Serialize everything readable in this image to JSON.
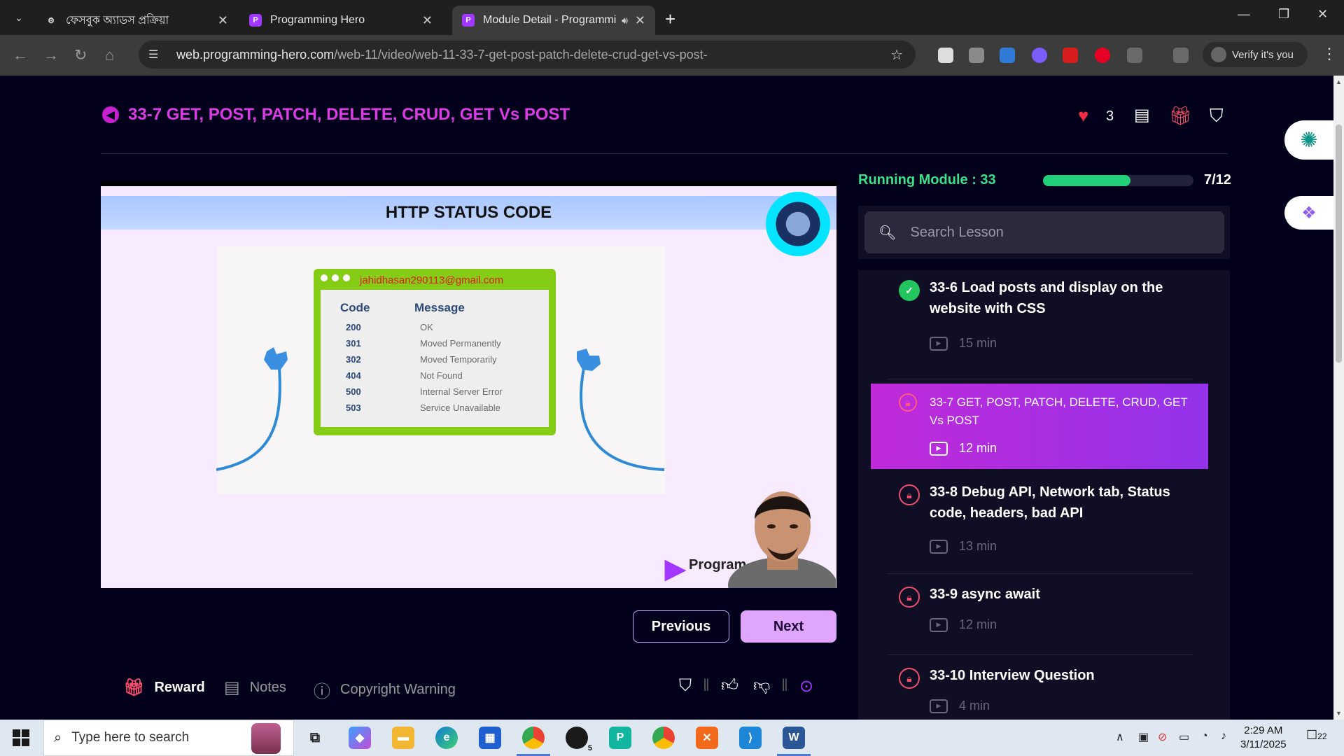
{
  "browser": {
    "tabs": [
      {
        "title": "ফেসবুক অ্যাডস প্রক্রিয়া",
        "active": false
      },
      {
        "title": "Programming Hero",
        "active": false
      },
      {
        "title": "Module Detail - Programmi",
        "active": true
      }
    ],
    "url_host": "web.programming-hero.com",
    "url_path": "/web-11/video/web-11-33-7-get-post-patch-delete-crud-get-vs-post-",
    "verify_label": "Verify it's you"
  },
  "header": {
    "lesson_title": "33-7 GET, POST, PATCH, DELETE, CRUD, GET Vs POST",
    "likes": "3"
  },
  "video": {
    "slide_title": "HTTP STATUS CODE",
    "email": "jahidhasan290113@gmail.com",
    "col_code": "Code",
    "col_message": "Message",
    "rows": [
      {
        "code": "200",
        "message": "OK"
      },
      {
        "code": "301",
        "message": "Moved Permanently"
      },
      {
        "code": "302",
        "message": "Moved Temporarily"
      },
      {
        "code": "404",
        "message": "Not Found"
      },
      {
        "code": "500",
        "message": "Internal Server Error"
      },
      {
        "code": "503",
        "message": "Service Unavailable"
      }
    ],
    "brand": "Program"
  },
  "nav": {
    "previous": "Previous",
    "next": "Next"
  },
  "bottom_tabs": {
    "reward": "Reward",
    "notes": "Notes",
    "copyright": "Copyright Warning"
  },
  "module": {
    "running_label": "Running Module : 33",
    "progress_text": "7/12",
    "progress_fraction": 0.58,
    "search_placeholder": "Search Lesson",
    "lessons": [
      {
        "title": "33-6 Load posts and display on the website with CSS",
        "duration": "15 min",
        "status": "completed"
      },
      {
        "title": "33-7  GET, POST, PATCH, DELETE, CRUD, GET Vs POST",
        "duration": "12 min",
        "status": "current"
      },
      {
        "title": "33-8 Debug API, Network tab, Status code, headers, bad API",
        "duration": "13 min",
        "status": "locked"
      },
      {
        "title": "33-9 async await",
        "duration": "12 min",
        "status": "locked"
      },
      {
        "title": "33-10 Interview Question",
        "duration": "4 min",
        "status": "locked"
      }
    ]
  },
  "taskbar": {
    "search_placeholder": "Type here to search",
    "time": "2:29 AM",
    "date": "3/11/2025",
    "notification_count": "22",
    "whatsapp_badge": "5"
  },
  "colors": {
    "accent": "#dc3be6",
    "progress": "#22d07a",
    "running": "#39e28a",
    "active_lesson": "#b12ddd",
    "page_bg": "#02001a"
  }
}
